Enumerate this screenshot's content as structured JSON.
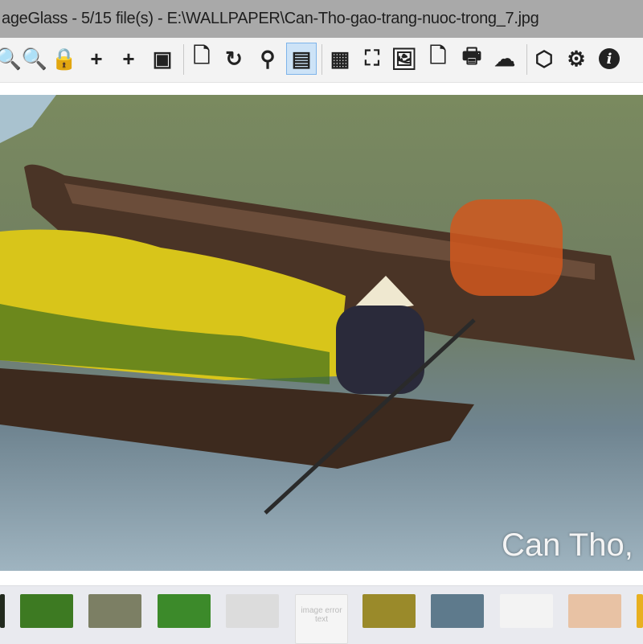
{
  "window": {
    "title": "ageGlass - 5/15 file(s) - E:\\WALLPAPER\\Can-Tho-gao-trang-nuoc-trong_7.jpg"
  },
  "toolbar": {
    "items": [
      {
        "name": "zoom-out",
        "glyph": "🔍"
      },
      {
        "name": "zoom-in",
        "glyph": "🔍"
      },
      {
        "name": "lock-zoom",
        "glyph": "🔒"
      },
      {
        "name": "scale-to-width",
        "glyph": "+"
      },
      {
        "name": "scale-to-height",
        "glyph": "+"
      },
      {
        "name": "auto-zoom",
        "glyph": "▣"
      },
      {
        "name": "open-file",
        "glyph": "🗋"
      },
      {
        "name": "refresh",
        "glyph": "↻"
      },
      {
        "name": "go-to-image",
        "glyph": "⚲"
      },
      {
        "name": "thumbnail-bar",
        "glyph": "▤",
        "active": true
      },
      {
        "name": "checkerboard",
        "glyph": "▦"
      },
      {
        "name": "fullscreen",
        "glyph": "⛶"
      },
      {
        "name": "slideshow",
        "glyph": "🖼"
      },
      {
        "name": "convert",
        "glyph": "🗋"
      },
      {
        "name": "print",
        "glyph": "🖶"
      },
      {
        "name": "upload",
        "glyph": "☁"
      },
      {
        "name": "extensions",
        "glyph": "⬡"
      },
      {
        "name": "settings",
        "glyph": "⚙"
      },
      {
        "name": "about",
        "glyph": "i"
      }
    ]
  },
  "image": {
    "caption": "Can Tho,"
  },
  "thumbnails": {
    "colors": [
      "#222a1e",
      "#3d7a22",
      "#7c7f64",
      "#3c8a2a",
      "#dcdcdc",
      "#f5f5f5",
      "#9a8a2a",
      "#5e7a8c",
      "#f3f3f3",
      "#e8c2a4",
      "#e8b020"
    ],
    "placeholder_text": "image error text"
  },
  "colors": {
    "accent": "#7eb4ea",
    "titlebar": "#a9a9a9"
  }
}
